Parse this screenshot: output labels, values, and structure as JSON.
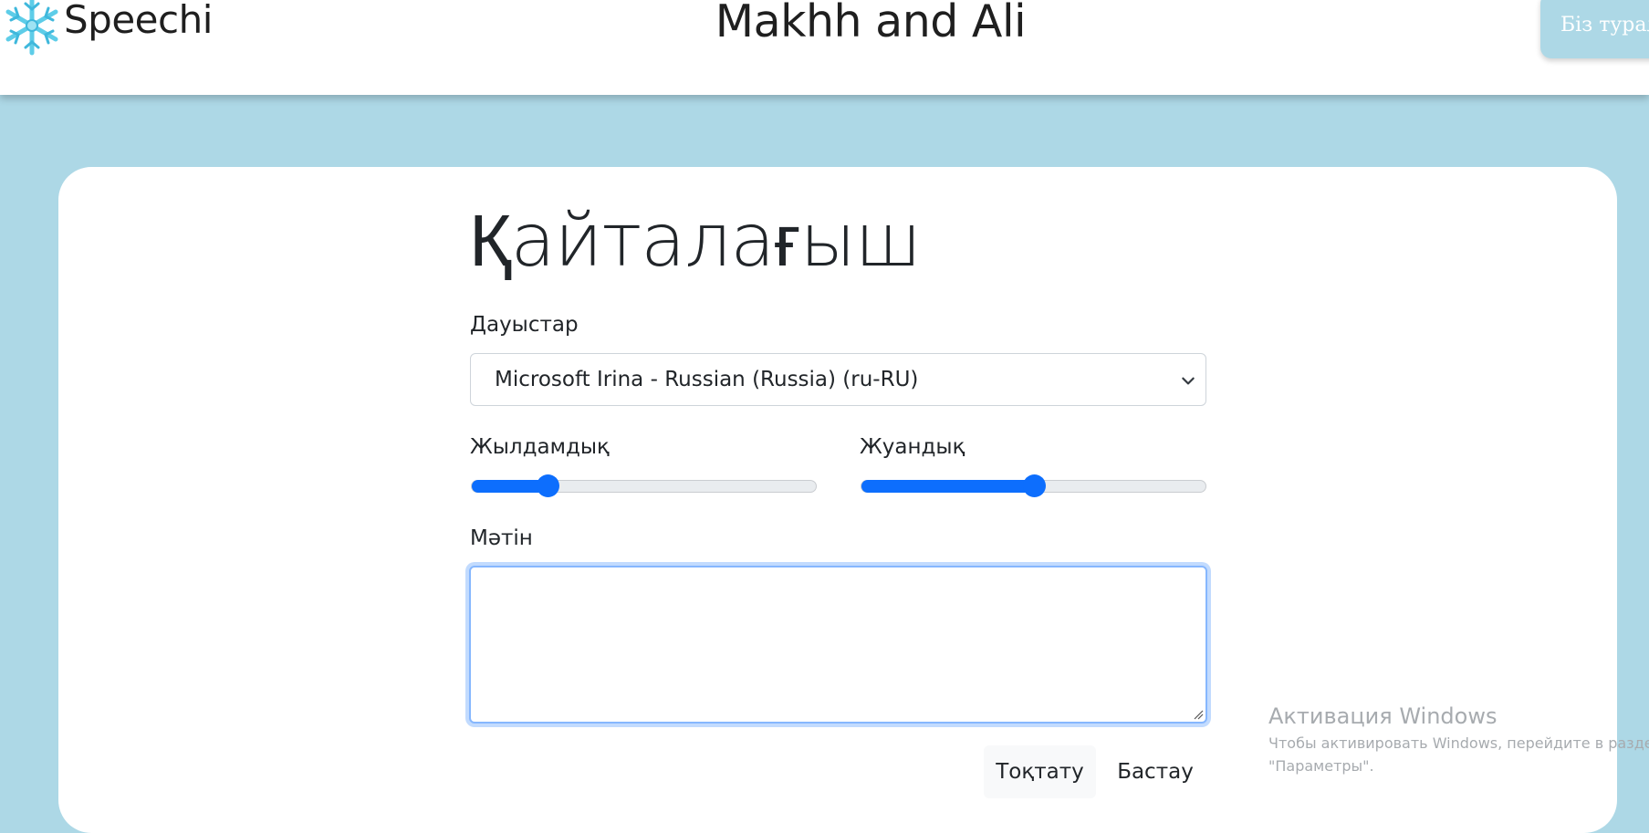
{
  "header": {
    "brand": "Speechi",
    "site_title": "Makhh and Ali",
    "about_button": "Біз турал"
  },
  "main": {
    "heading": "Қайталағыш",
    "voices_label": "Дауыстар",
    "voice_selected": "Microsoft Irina - Russian (Russia) (ru-RU)",
    "speed_label": "Жылдамдық",
    "speed_value": 0.22,
    "pitch_label": "Жуандық",
    "pitch_value": 0.5,
    "text_label": "Мәтін",
    "text_value": "",
    "stop_button": "Тоқтату",
    "start_button": "Бастау"
  },
  "watermark": {
    "title": "Активация Windows",
    "line1": "Чтобы активировать Windows, перейдите в раздел",
    "line2": "\"Параметры\"."
  },
  "colors": {
    "background": "#add8e6",
    "accent": "#0d6efd",
    "logo": "#5ecde8"
  },
  "icons": {
    "logo": "snowflake-icon",
    "select": "chevron-down-icon"
  }
}
